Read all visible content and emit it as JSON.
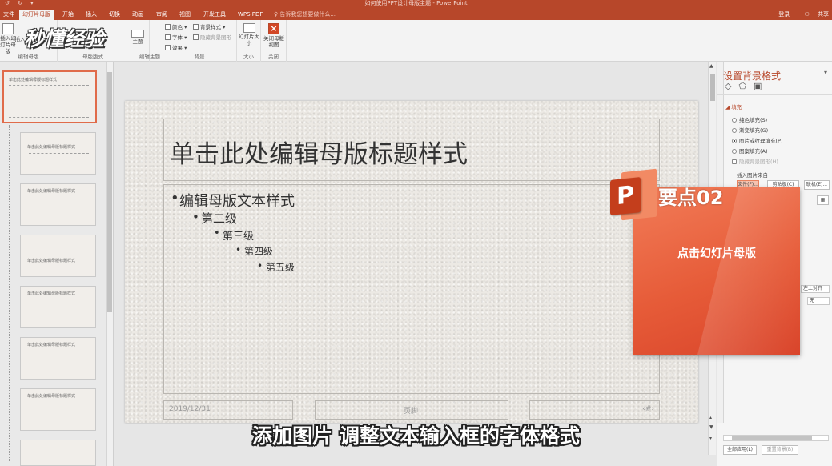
{
  "window": {
    "title": "如何使用PPT设计母版主题 - PowerPoint"
  },
  "tabs": [
    {
      "label": "文件"
    },
    {
      "label": "幻灯片母版"
    },
    {
      "label": "开始"
    },
    {
      "label": "插入"
    },
    {
      "label": "切换"
    },
    {
      "label": "动画"
    },
    {
      "label": "审阅"
    },
    {
      "label": "视图"
    },
    {
      "label": "开发工具"
    },
    {
      "label": "WPS PDF"
    }
  ],
  "tell_me": "告诉我您想要做什么...",
  "account": {
    "login": "登录",
    "share": "共享"
  },
  "ribbon": {
    "insert_master": "插入幻灯片母版",
    "insert_master_short": "插入",
    "edit_master": "编辑母版",
    "master_layout": "母版版式",
    "edit_theme": "编辑主题",
    "theme": "主题",
    "colors": "颜色",
    "fonts": "字体",
    "effects": "效果",
    "bg_styles": "背景样式",
    "hide_bg": "隐藏背景图形",
    "background": "背景",
    "slide_size": "幻灯片大小",
    "size": "大小",
    "close_master_view": "关闭母版视图",
    "close": "关闭"
  },
  "watermark": "秒懂经验",
  "slide": {
    "title": "单击此处编辑母版标题样式",
    "levels": [
      "编辑母版文本样式",
      "第二级",
      "第三级",
      "第四级",
      "第五级"
    ],
    "date": "2019/12/31",
    "footer": "页脚",
    "page_num": "‹#›"
  },
  "thumbnails": [
    {
      "title": "单击此处编辑母版标题样式"
    },
    {
      "title": "单击此处编辑母版标题样式"
    },
    {
      "title": "单击此处编辑母版标题样式"
    },
    {
      "title": "单击此处编辑母版标题样式"
    },
    {
      "title": "单击此处编辑母版标题样式"
    },
    {
      "title": "单击此处编辑母版标题样式"
    },
    {
      "title": "单击此处编辑母版标题样式"
    }
  ],
  "format_pane": {
    "title": "设置背景格式",
    "fill_header": "填充",
    "options": [
      {
        "label": "纯色填充(S)",
        "checked": false
      },
      {
        "label": "渐变填充(G)",
        "checked": false
      },
      {
        "label": "图片或纹理填充(P)",
        "checked": true
      },
      {
        "label": "图案填充(A)",
        "checked": false
      }
    ],
    "hide_bg_graphics": "隐藏背景图形(H)",
    "insert_from": "插入图片来自",
    "file_btn": "文件(F)...",
    "clipboard_btn": "剪贴板(C)",
    "online_btn": "联机(E)...",
    "align": "左上对齐",
    "mirror": "无",
    "apply_all": "全部应用(L)",
    "reset_bg": "重置背景(B)"
  },
  "callout": {
    "title": "要点02",
    "subtitle": "点击幻灯片母版"
  },
  "caption": "添加图片 调整文本输入框的字体格式",
  "colors": {
    "accent": "#b7472a",
    "callout": "#e65b38"
  }
}
